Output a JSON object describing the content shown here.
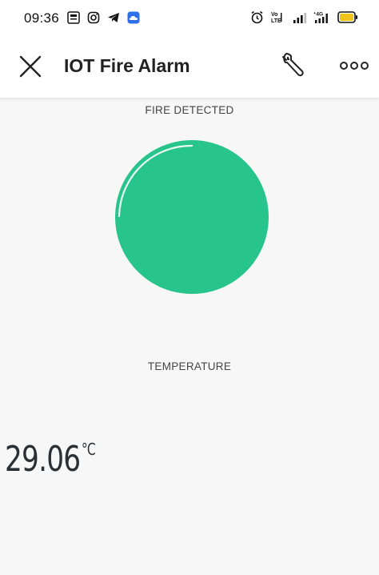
{
  "status_bar": {
    "time": "09:36"
  },
  "app_bar": {
    "title": "IOT Fire Alarm"
  },
  "fire_widget": {
    "label": "FIRE DETECTED",
    "led_color": "#27c48d"
  },
  "temperature_widget": {
    "label": "TEMPERATURE",
    "value": "29.06",
    "unit": "°C"
  },
  "colors": {
    "background": "#f7f7f8",
    "app_bar": "#ffffff",
    "led": "#27c48d"
  }
}
